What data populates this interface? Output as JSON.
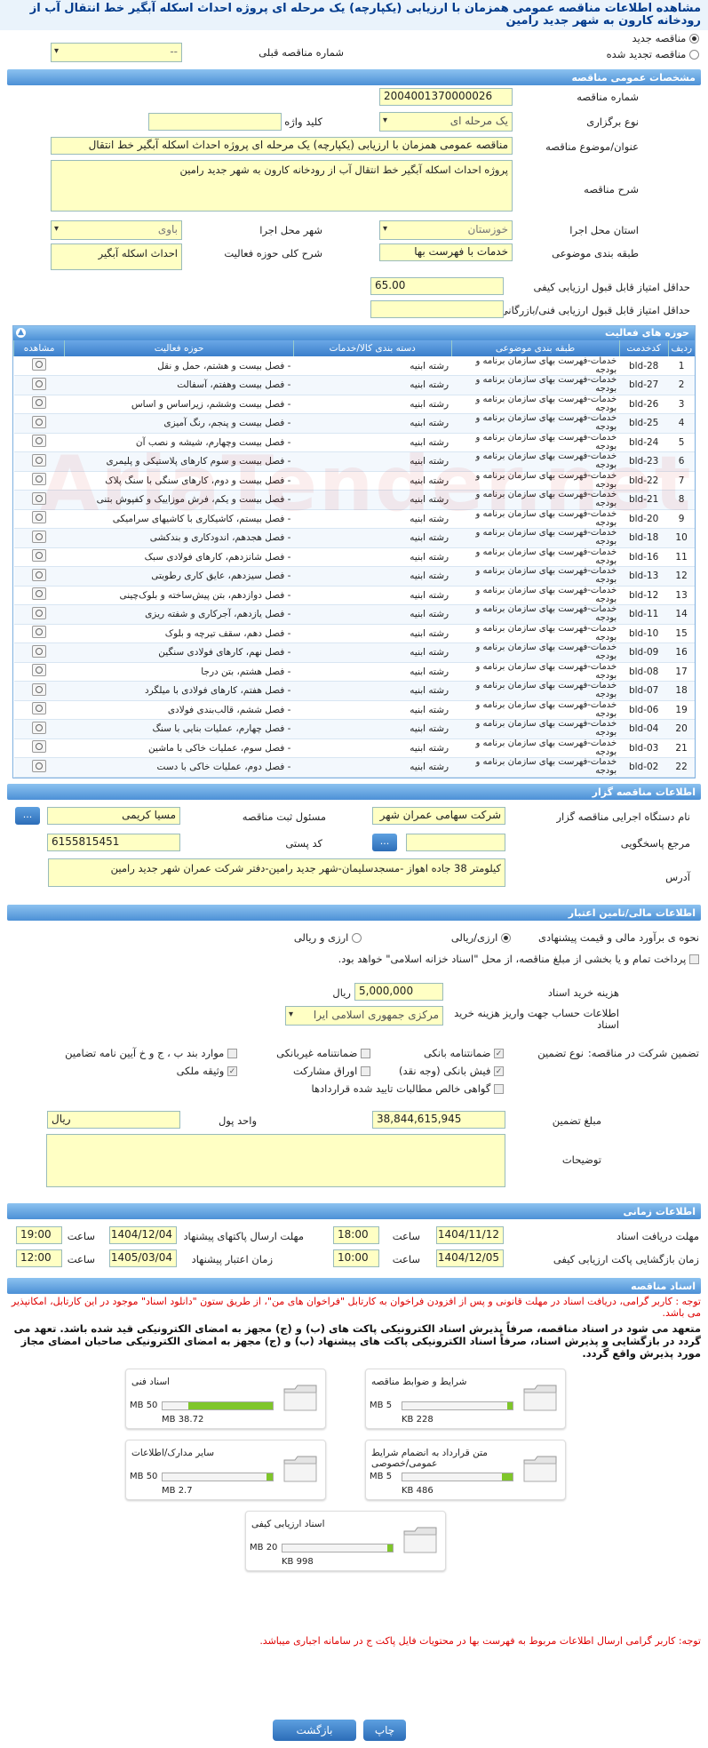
{
  "title": "مشاهده اطلاعات مناقصه عمومی همزمان با ارزیابی (یکپارچه) یک مرحله ای پروژه احداث اسکله آبگیر خط انتقال آب از رودخانه کارون به شهر جدید رامین",
  "tender_type": {
    "new": "مناقصه جدید",
    "renewed": "مناقصه تجدید شده",
    "prev_no_label": "شماره مناقصه قبلی",
    "prev_no_value": "--"
  },
  "general": {
    "header": "مشخصات عمومی مناقصه",
    "number_label": "شماره مناقصه",
    "number": "2004001370000026",
    "holding_label": "نوع برگزاری",
    "holding": "یک مرحله ای",
    "keyword_label": "کلید واژه",
    "keyword": "",
    "subject_label": "عنوان/موضوع مناقصه",
    "subject": "مناقصه عمومی همزمان با ارزیابی (یکپارچه) یک مرحله ای پروژه احداث اسکله آبگیر خط انتقال",
    "desc_label": "شرح مناقصه",
    "desc": "پروژه احداث اسکله آبگیر خط انتقال آب از رودخانه کارون به شهر جدید رامین",
    "province_label": "استان محل اجرا",
    "province": "خوزستان",
    "city_label": "شهر محل اجرا",
    "city": "باوی",
    "category_label": "طبقه بندی موضوعی",
    "category": "خدمات با فهرست بها",
    "scope_label": "شرح کلی حوزه فعالیت",
    "scope": "احداث اسکله آبگیر",
    "min_quality_label": "حداقل امتیاز قابل قبول ارزیابی کیفی",
    "min_quality": "65.00",
    "min_tech_label": "حداقل امتیاز قابل قبول ارزیابی فنی/بازرگانی",
    "min_tech": ""
  },
  "activity": {
    "header": "حوزه های فعالیت",
    "columns": [
      "ردیف",
      "کدخدمت",
      "طبقه بندی موضوعی",
      "دسته بندی کالا/خدمات",
      "حوزه فعالیت",
      "مشاهده"
    ],
    "rows": [
      {
        "n": "1",
        "code": "bld-28",
        "cat": "خدمات-فهرست بهای سازمان برنامه و بودجه",
        "group": "رشته ابنیه",
        "scope": "- فصل بیست و هشتم، حمل و نقل"
      },
      {
        "n": "2",
        "code": "bld-27",
        "cat": "خدمات-فهرست بهای سازمان برنامه و بودجه",
        "group": "رشته ابنیه",
        "scope": "- فصل بیست وهفتم، آسفالت"
      },
      {
        "n": "3",
        "code": "bld-26",
        "cat": "خدمات-فهرست بهای سازمان برنامه و بودجه",
        "group": "رشته ابنیه",
        "scope": "- فصل بیست وششم، زیراساس و اساس"
      },
      {
        "n": "4",
        "code": "bld-25",
        "cat": "خدمات-فهرست بهای سازمان برنامه و بودجه",
        "group": "رشته ابنیه",
        "scope": "- فصل بیست و پنجم، رنگ آمیزی"
      },
      {
        "n": "5",
        "code": "bld-24",
        "cat": "خدمات-فهرست بهای سازمان برنامه و بودجه",
        "group": "رشته ابنیه",
        "scope": "- فصل بیست وچهارم، شیشه و نصب آن"
      },
      {
        "n": "6",
        "code": "bld-23",
        "cat": "خدمات-فهرست بهای سازمان برنامه و بودجه",
        "group": "رشته ابنیه",
        "scope": "- فصل بیست و سوم کارهای پلاستیکی و پلیمری"
      },
      {
        "n": "7",
        "code": "bld-22",
        "cat": "خدمات-فهرست بهای سازمان برنامه و بودجه",
        "group": "رشته ابنیه",
        "scope": "- فصل بیست و دوم، کارهای سنگی با سنگ پلاک"
      },
      {
        "n": "8",
        "code": "bld-21",
        "cat": "خدمات-فهرست بهای سازمان برنامه و بودجه",
        "group": "رشته ابنیه",
        "scope": "- فصل بیست و یکم، فرش موزاییک و کفپوش بتنی"
      },
      {
        "n": "9",
        "code": "bld-20",
        "cat": "خدمات-فهرست بهای سازمان برنامه و بودجه",
        "group": "رشته ابنیه",
        "scope": "- فصل بیستم، کاشیکاری با کاشیهای سرامیکی"
      },
      {
        "n": "10",
        "code": "bld-18",
        "cat": "خدمات-فهرست بهای سازمان برنامه و بودجه",
        "group": "رشته ابنیه",
        "scope": "- فصل هجدهم، اندودکاری و بندکشی"
      },
      {
        "n": "11",
        "code": "bld-16",
        "cat": "خدمات-فهرست بهای سازمان برنامه و بودجه",
        "group": "رشته ابنیه",
        "scope": "- فصل شانزدهم، کارهای فولادی سبک"
      },
      {
        "n": "12",
        "code": "bld-13",
        "cat": "خدمات-فهرست بهای سازمان برنامه و بودجه",
        "group": "رشته ابنیه",
        "scope": "- فصل سیزدهم، عایق کاری رطوبتی"
      },
      {
        "n": "13",
        "code": "bld-12",
        "cat": "خدمات-فهرست بهای سازمان برنامه و بودجه",
        "group": "رشته ابنیه",
        "scope": "- فصل دوازدهم، بتن پیش‌ساخته و بلوک‌چینی"
      },
      {
        "n": "14",
        "code": "bld-11",
        "cat": "خدمات-فهرست بهای سازمان برنامه و بودجه",
        "group": "رشته ابنیه",
        "scope": "- فصل یازدهم، آجرکاری و شفته ریزی"
      },
      {
        "n": "15",
        "code": "bld-10",
        "cat": "خدمات-فهرست بهای سازمان برنامه و بودجه",
        "group": "رشته ابنیه",
        "scope": "- فصل دهم، سقف تیرچه و بلوک"
      },
      {
        "n": "16",
        "code": "bld-09",
        "cat": "خدمات-فهرست بهای سازمان برنامه و بودجه",
        "group": "رشته ابنیه",
        "scope": "- فصل نهم، کارهای فولادی سنگین"
      },
      {
        "n": "17",
        "code": "bld-08",
        "cat": "خدمات-فهرست بهای سازمان برنامه و بودجه",
        "group": "رشته ابنیه",
        "scope": "- فصل هشتم، بتن درجا"
      },
      {
        "n": "18",
        "code": "bld-07",
        "cat": "خدمات-فهرست بهای سازمان برنامه و بودجه",
        "group": "رشته ابنیه",
        "scope": "- فصل هفتم، کارهای فولادی با میلگرد"
      },
      {
        "n": "19",
        "code": "bld-06",
        "cat": "خدمات-فهرست بهای سازمان برنامه و بودجه",
        "group": "رشته ابنیه",
        "scope": "- فصل ششم، قالب‌بندی فولادی"
      },
      {
        "n": "20",
        "code": "bld-04",
        "cat": "خدمات-فهرست بهای سازمان برنامه و بودجه",
        "group": "رشته ابنیه",
        "scope": "- فصل چهارم، عملیات بنایی با سنگ"
      },
      {
        "n": "21",
        "code": "bld-03",
        "cat": "خدمات-فهرست بهای سازمان برنامه و بودجه",
        "group": "رشته ابنیه",
        "scope": "- فصل سوم، عملیات خاکی با ماشین"
      },
      {
        "n": "22",
        "code": "bld-02",
        "cat": "خدمات-فهرست بهای سازمان برنامه و بودجه",
        "group": "رشته ابنیه",
        "scope": "- فصل دوم، عملیات خاکی با دست"
      }
    ]
  },
  "organizer": {
    "header": "اطلاعات مناقصه گزار",
    "org_label": "نام دستگاه اجرایی مناقصه گزار",
    "org": "شرکت سهامی عمران شهر",
    "responsible_label": "مسئول ثبت مناقصه",
    "responsible": "مسیا کریمی",
    "ref_label": "مرجع پاسخگویی",
    "ref": "",
    "postal_label": "کد پستی",
    "postal": "6155815451",
    "address_label": "آدرس",
    "address": "کیلومتر 38 جاده اهواز -مسجدسلیمان-شهر جدید رامین-دفتر شرکت عمران شهر جدید رامین",
    "dots": "..."
  },
  "financial": {
    "header": "اطلاعات مالی/تامین اعتبار",
    "estimate_label": "نحوه ی برآورد مالی و قیمت پیشنهادی",
    "opt_rial": "ارزی/ریالی",
    "opt_both": "ارزی و ریالی",
    "treasury_note": "پرداخت تمام و یا بخشی از مبلغ مناقصه، از محل \"اسناد خزانه اسلامی\" خواهد بود.",
    "doc_fee_label": "هزینه خرید اسناد",
    "doc_fee": "5,000,000",
    "currency": "ریال",
    "account_label": "اطلاعات حساب جهت واریز هزینه خرید اسناد",
    "account": "مرکزی جمهوری اسلامی ایرا",
    "guarantee_label": "تضمین شرکت در مناقصه:",
    "guarantee_type_label": "نوع تضمین",
    "g1": "ضمانتنامه بانکی",
    "g2": "ضمانتنامه غیربانکی",
    "g3": "موارد بند ب ، ج و خ آیین نامه تضامین",
    "g4": "فیش بانکی (وجه نقد)",
    "g5": "اوراق مشارکت",
    "g6": "وثیقه ملکی",
    "g7": "گواهی خالص مطالبات تایید شده قراردادها",
    "amount_label": "مبلغ تضمین",
    "amount": "38,844,615,945",
    "unit_label": "واحد پول",
    "unit": "ریال",
    "notes_label": "توضیحات",
    "notes": ""
  },
  "timing": {
    "header": "اطلاعات زمانی",
    "receive_label": "مهلت دریافت اسناد",
    "receive_date": "1404/11/12",
    "receive_time": "18:00",
    "send_label": "مهلت ارسال پاکتهای پیشنهاد",
    "send_date": "1404/12/04",
    "send_time": "19:00",
    "open_label": "زمان بازگشایی پاکت ارزیابی کیفی",
    "open_date": "1404/12/05",
    "open_time": "10:00",
    "validity_label": "زمان اعتبار پیشنهاد",
    "validity_date": "1405/03/04",
    "validity_time": "12:00",
    "time_label": "ساعت"
  },
  "docs": {
    "header": "اسناد مناقصه",
    "note1": "توجه : کاربر گرامی، دریافت اسناد در مهلت قانونی و پس از افزودن فراخوان به کارتابل \"فراخوان های من\"، از طریق ستون \"دانلود اسناد\" موجود در این کارتابل، امکانپذیر می باشد.",
    "note2": "متعهد می شود در اسناد مناقصه، صرفاً پذیرش اسناد الکترونیکی پاکت های (ب) و (ج) مجهز به امضای الکترونیکی قید شده باشد. تعهد می گردد در بازگشایی و پذیرش اسناد، صرفاً اسناد الکترونیکی پاکت های پیشنهاد (ب) و (ج) مجهز به امضای الکترونیکی صاحبان امضای مجاز مورد پذیرش واقع گردد.",
    "files": [
      {
        "name": "شرایط و ضوابط مناقصه",
        "max": "5 MB",
        "cur": "228 KB",
        "pct": 0.05
      },
      {
        "name": "اسناد فنی",
        "max": "50 MB",
        "cur": "38.72 MB",
        "pct": 0.77
      },
      {
        "name": "متن قرارداد به انضمام شرایط عمومی/خصوصی",
        "max": "5 MB",
        "cur": "486 KB",
        "pct": 0.1
      },
      {
        "name": "سایر مدارک/اطلاعات",
        "max": "50 MB",
        "cur": "2.7 MB",
        "pct": 0.06
      },
      {
        "name": "اسناد ارزیابی کیفی",
        "max": "20 MB",
        "cur": "998 KB",
        "pct": 0.05
      }
    ],
    "note3": "توجه: کاربر گرامی ارسال اطلاعات مربوط به فهرست بها در محتویات فایل پاکت ج در سامانه اجباری میباشد."
  },
  "buttons": {
    "print": "چاپ",
    "back": "بازگشت"
  }
}
